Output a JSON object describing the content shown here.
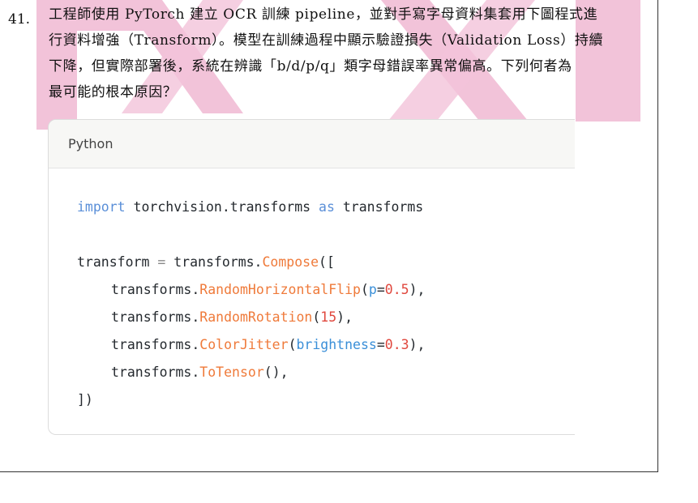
{
  "question": {
    "number": "41.",
    "lines": [
      "工程師使用 PyTorch 建立 OCR 訓練 pipeline，並對手寫字母資料集套用下圖程式進",
      "行資料增強（Transform）。模型在訓練過程中顯示驗證損失（Validation Loss）持續",
      "下降，但實際部署後，系統在辨識「b/d/p/q」類字母錯誤率異常偏高。下列何者為",
      "最可能的根本原因？"
    ]
  },
  "code_block": {
    "language": "Python",
    "tokens": {
      "import": "import",
      "module": "torchvision.transforms",
      "as": "as",
      "alias": "transforms",
      "var": "transform",
      "eq": "=",
      "prefix": "transforms.",
      "compose": "Compose",
      "open": "([",
      "hflip": "RandomHorizontalFlip",
      "p_arg": "p",
      "p_val": "0.5",
      "rotation": "RandomRotation",
      "rot_val": "15",
      "jitter": "ColorJitter",
      "bright_arg": "brightness",
      "bright_val": "0.3",
      "totensor": "ToTensor",
      "close": "])"
    }
  },
  "colors": {
    "watermark_pink": "#f2c3d9",
    "keyword": "#5a8fd8",
    "function": "#ef7a3a",
    "number": "#e0483e"
  }
}
